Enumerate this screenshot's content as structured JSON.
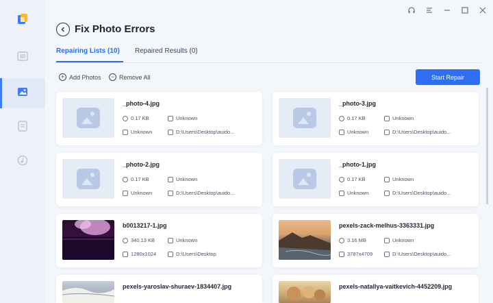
{
  "header": {
    "title": "Fix Photo Errors"
  },
  "tabs": [
    {
      "label": "Repairing Lists (10)",
      "active": true
    },
    {
      "label": "Repaired Results (0)",
      "active": false
    }
  ],
  "toolbar": {
    "add_label": "Add Photos",
    "remove_label": "Remove All",
    "start_label": "Start Repair"
  },
  "sidebar": {
    "items": [
      {
        "icon": "video-icon"
      },
      {
        "icon": "photo-icon",
        "active": true
      },
      {
        "icon": "document-icon"
      },
      {
        "icon": "audio-icon"
      }
    ]
  },
  "window_controls": [
    "headset-icon",
    "menu-icon",
    "minimize-icon",
    "maximize-icon",
    "close-icon"
  ],
  "colors": {
    "accent": "#2f6ff2",
    "background": "#f3f6fb"
  },
  "files": [
    {
      "name": "_photo-4.jpg",
      "size": "0.17 KB",
      "format": "Unknown",
      "resolution": "Unknown",
      "path": "D:\\Users\\Desktop\\auido..."
    },
    {
      "name": "_photo-3.jpg",
      "size": "0.17 KB",
      "format": "Unknown",
      "resolution": "Unknown",
      "path": "D:\\Users\\Desktop\\auido..."
    },
    {
      "name": "_photo-2.jpg",
      "size": "0.17 KB",
      "format": "Unknown",
      "resolution": "Unknown",
      "path": "D:\\Users\\Desktop\\auido..."
    },
    {
      "name": "_photo-1.jpg",
      "size": "0.17 KB",
      "format": "Unknown",
      "resolution": "Unknown",
      "path": "D:\\Users\\Desktop\\auido..."
    },
    {
      "name": "b0013217-1.jpg",
      "size": "340.13 KB",
      "format": "Unknown",
      "resolution": "1280x1024",
      "path": "D:\\Users\\Desktop"
    },
    {
      "name": "pexels-zack-melhus-3363331.jpg",
      "size": "3.16 MB",
      "format": "Unknown",
      "resolution": "3787x4709",
      "path": "D:\\Users\\Desktop\\auido..."
    },
    {
      "name": "pexels-yaroslav-shuraev-1834407.jpg"
    },
    {
      "name": "pexels-natallya-vaitkevich-4452209.jpg"
    }
  ]
}
